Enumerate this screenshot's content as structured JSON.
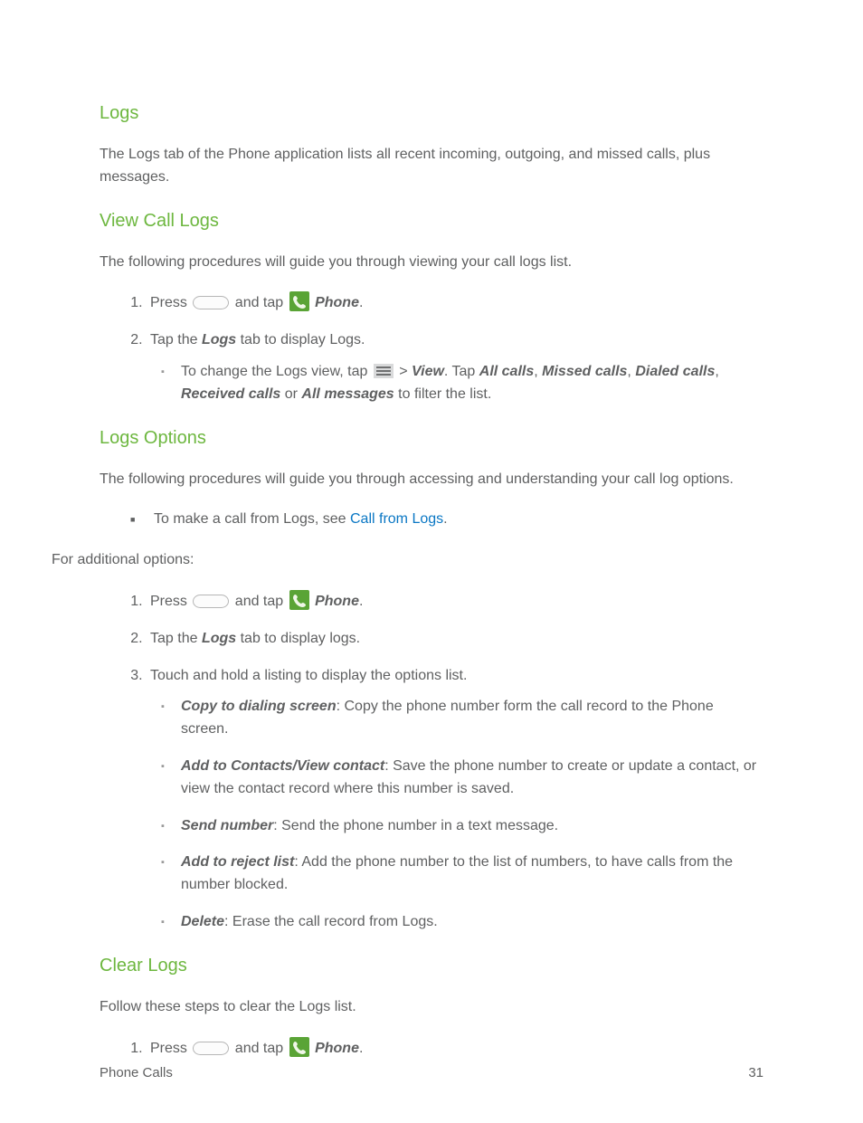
{
  "section1": {
    "title": "Logs",
    "intro": "The Logs tab of the Phone application lists all recent incoming, outgoing, and missed calls, plus messages."
  },
  "section2": {
    "title": "View Call Logs",
    "intro": "The following procedures will guide you through viewing your call logs list.",
    "step1_a": "Press ",
    "step1_b": " and tap ",
    "step1_c": " Phone",
    "step1_d": ".",
    "step2_a": "Tap the ",
    "step2_b": "Logs",
    "step2_c": " tab to display Logs.",
    "bullet_a": "To change the Logs view, tap ",
    "bullet_b": " > ",
    "bullet_c": "View",
    "bullet_d": ". Tap ",
    "bullet_e": "All calls",
    "bullet_f": ", ",
    "bullet_g": "Missed calls",
    "bullet_h": ", ",
    "bullet_i": "Dialed calls",
    "bullet_j": ", ",
    "bullet_k": "Received calls",
    "bullet_l": " or ",
    "bullet_m": "All messages",
    "bullet_n": " to filter the list."
  },
  "section3": {
    "title": "Logs Options",
    "intro": "The following procedures will guide you through accessing and understanding your call log options.",
    "bullet1_a": "To make a call from Logs, see ",
    "bullet1_link": "Call from Logs",
    "bullet1_b": ".",
    "additional": "For additional options:",
    "step1_a": "Press ",
    "step1_b": " and tap ",
    "step1_c": " Phone",
    "step1_d": ".",
    "step2_a": "Tap the ",
    "step2_b": "Logs",
    "step2_c": " tab to display logs.",
    "step3": "Touch and hold a listing to display the options list.",
    "opt1_label": "Copy to dialing screen",
    "opt1_text": ": Copy the phone number form the call record to the Phone screen.",
    "opt2_label": "Add to Contacts/View contact",
    "opt2_text": ": Save the phone number to create or update a contact, or view the contact record where this number is saved.",
    "opt3_label": "Send number",
    "opt3_text": ": Send the phone number in a text message.",
    "opt4_label": "Add to reject list",
    "opt4_text": ": Add the phone number to the list of numbers, to have calls from the number blocked.",
    "opt5_label": "Delete",
    "opt5_text": ": Erase the call record from Logs."
  },
  "section4": {
    "title": "Clear Logs",
    "intro": "Follow these steps to clear the Logs list.",
    "step1_a": "Press ",
    "step1_b": " and tap ",
    "step1_c": " Phone",
    "step1_d": "."
  },
  "footer": {
    "left": "Phone Calls",
    "right": "31"
  }
}
